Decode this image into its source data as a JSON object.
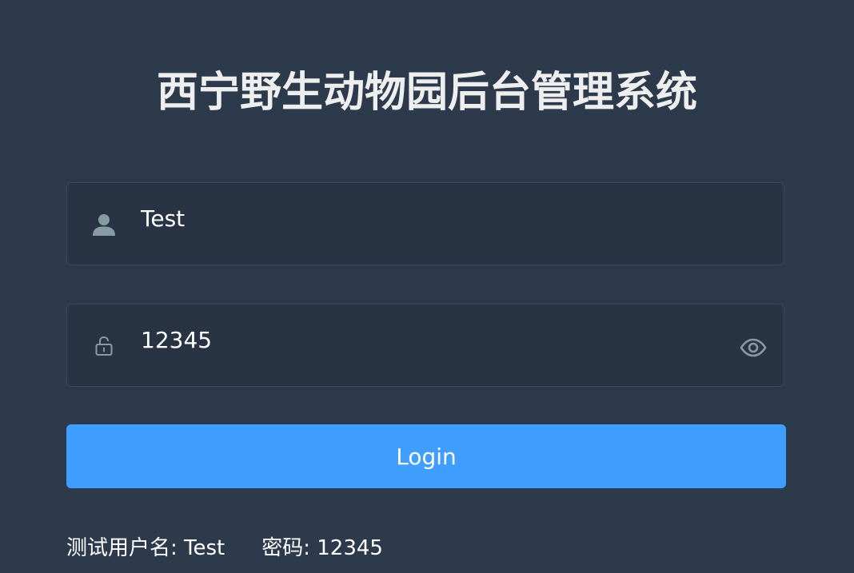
{
  "page": {
    "title": "西宁野生动物园后台管理系统"
  },
  "form": {
    "username": {
      "value": "Test",
      "icon": "user-icon"
    },
    "password": {
      "value": "12345",
      "icon": "lock-icon",
      "toggle_icon": "eye-icon"
    },
    "login_label": "Login"
  },
  "tips": {
    "username_label": "测试用户名: Test",
    "password_label": "密码: 12345"
  },
  "colors": {
    "background": "#2d3a4b",
    "button": "#409eff",
    "icon": "#889aa4"
  }
}
